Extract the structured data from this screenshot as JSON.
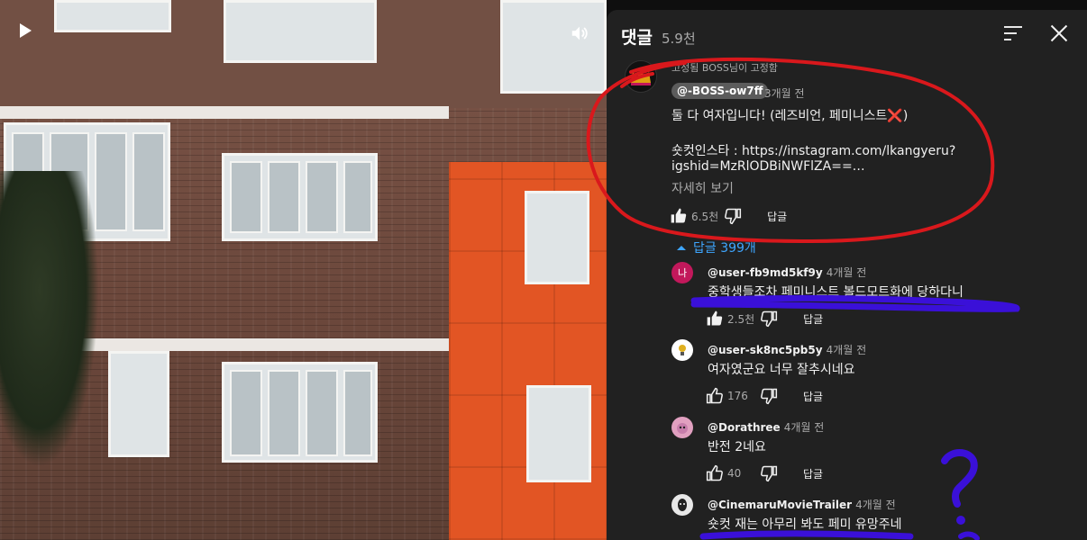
{
  "video": {
    "play_icon": "play-icon",
    "volume_icon": "volume-icon"
  },
  "panel": {
    "title": "댓글",
    "count": "5.9천",
    "sort_icon": "sort-icon",
    "close_icon": "close-icon"
  },
  "pinned": {
    "pinned_by": "고정됨 BOSS님이 고정함",
    "author": "@-BOSS-ow7ff",
    "time": "3개월 전",
    "text_line1": "둘 다 여자입니다! (레즈비언, 페미니스트❌)",
    "text_line2": "숏컷인스타 : https://instagram.com/lkangyeru?",
    "text_line3": "igshid=MzRlODBiNWFlZA==…",
    "read_more": "자세히 보기",
    "likes": "6.5천",
    "reply": "답글",
    "replies_toggle": "답글 399개"
  },
  "replies": [
    {
      "avatar_text": "나",
      "avatar_color": "#c2185b",
      "author": "@user-fb9md5kf9y",
      "time": "4개월 전",
      "text": "중학생들조차 페미니스트 볼드모트화에 당하다니",
      "likes": "2.5천",
      "reply": "답글"
    },
    {
      "avatar_text": "",
      "avatar_color": "#ffffff",
      "author": "@user-sk8nc5pb5y",
      "time": "4개월 전",
      "text": "여자였군요 너무 잘추시네요",
      "likes": "176",
      "reply": "답글"
    },
    {
      "avatar_text": "",
      "avatar_color": "#e1a0c0",
      "author": "@Dorathree",
      "time": "4개월 전",
      "text": "반전 2네요",
      "likes": "40",
      "reply": "답글"
    },
    {
      "avatar_text": "",
      "avatar_color": "#e8e8e8",
      "author": "@CinemaruMovieTrailer",
      "time": "4개월 전",
      "text": "숏컷 재는 아무리 봐도 페미 유망주네",
      "likes": "",
      "reply": ""
    }
  ],
  "colors": {
    "panel_bg": "#212121",
    "link_blue": "#3ea6ff",
    "annotation_red": "#d9181c",
    "annotation_purple": "#3a10d8"
  }
}
